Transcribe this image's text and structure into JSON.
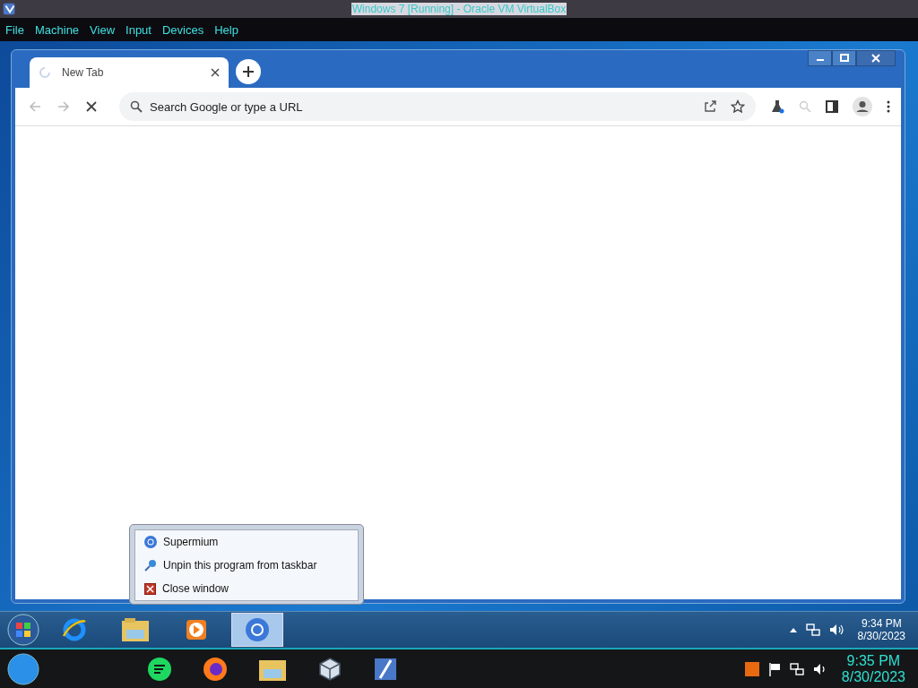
{
  "host_window": {
    "title": "Windows 7 [Running] - Oracle VM VirtualBox"
  },
  "host_menu": [
    "File",
    "Machine",
    "View",
    "Input",
    "Devices",
    "Help"
  ],
  "browser": {
    "tabs": [
      {
        "label": "New Tab",
        "selected": true
      }
    ],
    "omnibox": {
      "placeholder": "Search Google or type a URL"
    }
  },
  "jump_list": {
    "items": [
      {
        "label": "Supermium",
        "kind": "app"
      },
      {
        "label": "Unpin this program from taskbar",
        "kind": "unpin"
      },
      {
        "label": "Close window",
        "kind": "close"
      }
    ]
  },
  "guest_taskbar": {
    "buttons": [
      {
        "kind": "ie",
        "selected": false
      },
      {
        "kind": "explorer",
        "selected": false
      },
      {
        "kind": "media",
        "selected": false
      },
      {
        "kind": "browser",
        "selected": true
      }
    ],
    "clock": {
      "time": "9:34 PM",
      "date": "8/30/2023"
    }
  },
  "host_taskbar": {
    "clock": {
      "time": "9:35 PM",
      "date": "8/30/2023"
    }
  }
}
